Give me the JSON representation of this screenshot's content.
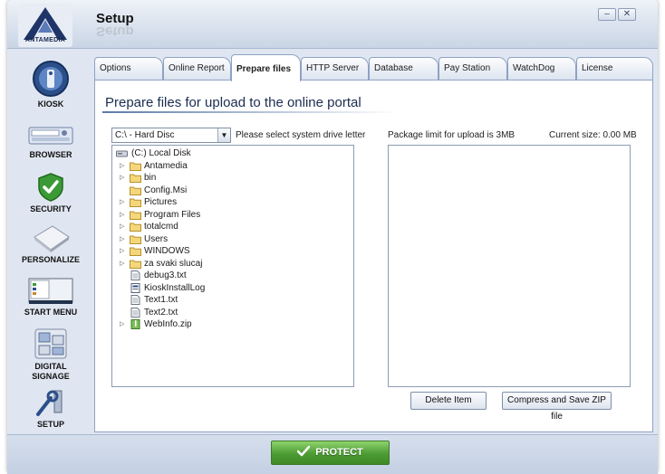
{
  "window": {
    "title": "Setup",
    "brand": "ANTAMEDIA"
  },
  "sidebar": {
    "items": [
      {
        "label": "KIOSK",
        "icon": "kiosk-icon"
      },
      {
        "label": "BROWSER",
        "icon": "browser-icon"
      },
      {
        "label": "SECURITY",
        "icon": "security-shield-icon"
      },
      {
        "label": "PERSONALIZE",
        "icon": "personalize-icon"
      },
      {
        "label": "START MENU",
        "icon": "start-menu-icon"
      },
      {
        "label": "DIGITAL\nSIGNAGE",
        "label_line1": "DIGITAL",
        "label_line2": "SIGNAGE",
        "icon": "digital-signage-icon"
      },
      {
        "label": "SETUP",
        "icon": "setup-icon"
      }
    ]
  },
  "tabs": [
    {
      "label": "Options"
    },
    {
      "label": "Online Report"
    },
    {
      "label": "Prepare files",
      "active": true
    },
    {
      "label": "HTTP Server"
    },
    {
      "label": "Database"
    },
    {
      "label": "Pay Station"
    },
    {
      "label": "WatchDog"
    },
    {
      "label": "License"
    }
  ],
  "main": {
    "heading": "Prepare files for upload to the online portal",
    "drive_select_value": "C:\\ - Hard Disc",
    "drive_hint": "Please select system drive letter",
    "package_limit": "Package limit for upload is 3MB",
    "current_size": "Current size: 0.00 MB",
    "tree": {
      "root": "(C:) Local Disk",
      "items": [
        {
          "name": "Antamedia",
          "type": "folder",
          "expandable": true
        },
        {
          "name": "bin",
          "type": "folder",
          "expandable": true
        },
        {
          "name": "Config.Msi",
          "type": "folder",
          "expandable": false
        },
        {
          "name": "Pictures",
          "type": "folder",
          "expandable": true
        },
        {
          "name": "Program Files",
          "type": "folder",
          "expandable": true
        },
        {
          "name": "totalcmd",
          "type": "folder",
          "expandable": true
        },
        {
          "name": "Users",
          "type": "folder",
          "expandable": true
        },
        {
          "name": "WINDOWS",
          "type": "folder",
          "expandable": true
        },
        {
          "name": "za svaki slucaj",
          "type": "folder",
          "expandable": true
        },
        {
          "name": "debug3.txt",
          "type": "file",
          "expandable": false
        },
        {
          "name": "KioskInstallLog",
          "type": "log",
          "expandable": false
        },
        {
          "name": "Text1.txt",
          "type": "file",
          "expandable": false
        },
        {
          "name": "Text2.txt",
          "type": "file",
          "expandable": false
        },
        {
          "name": "WebInfo.zip",
          "type": "zip",
          "expandable": true
        }
      ]
    },
    "delete_button": "Delete Item",
    "compress_button": "Compress and Save ZIP file"
  },
  "footer": {
    "protect_label": "PROTECT"
  },
  "colors": {
    "accent": "#4c9b33",
    "panel_border": "#8ea2c2",
    "heading": "#1b2d4f"
  }
}
